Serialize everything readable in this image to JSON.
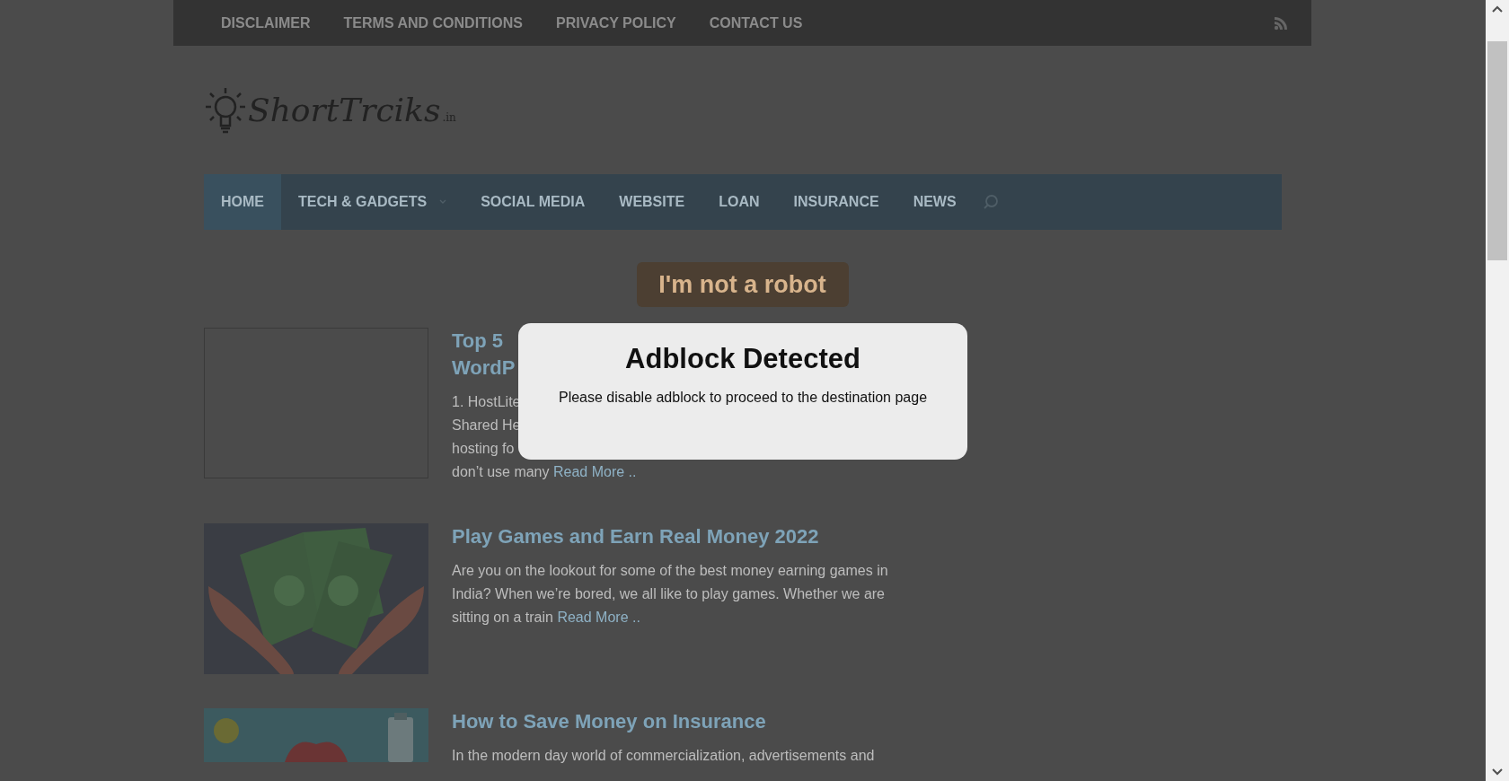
{
  "top_menu": [
    {
      "label": "DISCLAIMER"
    },
    {
      "label": "TERMS AND CONDITIONS"
    },
    {
      "label": "PRIVACY POLICY"
    },
    {
      "label": "CONTACT US"
    }
  ],
  "logo": {
    "text": "ShortTrciks",
    "suffix": ".in"
  },
  "nav": [
    {
      "label": "HOME",
      "selected": true,
      "has_submenu": false
    },
    {
      "label": "TECH & GADGETS",
      "selected": false,
      "has_submenu": true
    },
    {
      "label": "SOCIAL MEDIA",
      "selected": false,
      "has_submenu": false
    },
    {
      "label": "WEBSITE",
      "selected": false,
      "has_submenu": false
    },
    {
      "label": "LOAN",
      "selected": false,
      "has_submenu": false
    },
    {
      "label": "INSURANCE",
      "selected": false,
      "has_submenu": false
    },
    {
      "label": "NEWS",
      "selected": false,
      "has_submenu": false
    }
  ],
  "robot_button": "I'm not a robot",
  "posts": [
    {
      "title_lines": [
        "Top 5",
        "WordP"
      ],
      "excerpt_lines": [
        "1. HostLite",
        "Shared He",
        "hosting fo",
        "don’t use many"
      ],
      "read_more": "Read More .."
    },
    {
      "title_lines": [
        "Play Games and Earn Real Money 2022"
      ],
      "excerpt": "Are you on the lookout for some of the best money earning games in India? When we’re bored, we all like to play games. Whether we are sitting on a train",
      "read_more": "Read More .."
    },
    {
      "title_lines": [
        "How to Save Money on Insurance"
      ],
      "excerpt": "In the modern day world of commercialization, advertisements and"
    }
  ],
  "modal": {
    "title": "Adblock Detected",
    "message": "Please disable adblock to proceed to the destination page"
  }
}
